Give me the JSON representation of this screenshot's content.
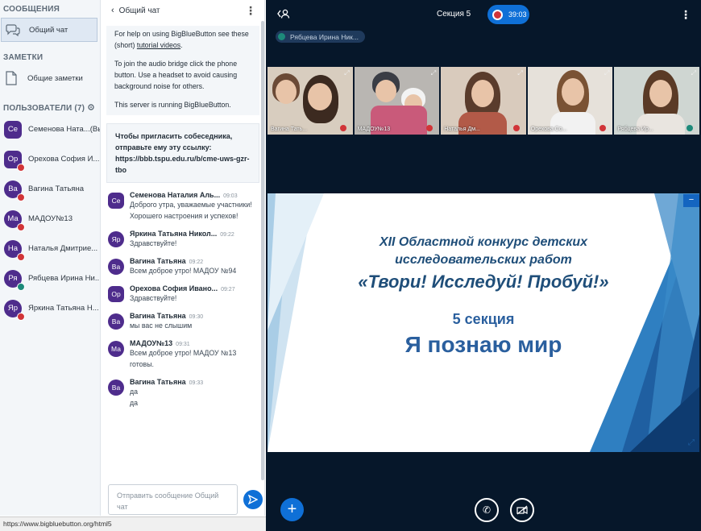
{
  "sidebar": {
    "messages_header": "СООБЩЕНИЯ",
    "public_chat_label": "Общий чат",
    "notes_header": "ЗАМЕТКИ",
    "shared_notes_label": "Общие заметки",
    "users_header": "ПОЛЬЗОВАТЕЛИ (7)",
    "users": [
      {
        "initials": "Се",
        "name": "Семенова Ната...(Вы)",
        "badge": "none",
        "shape": "square"
      },
      {
        "initials": "Ор",
        "name": "Орехова София И...",
        "badge": "red",
        "shape": "square"
      },
      {
        "initials": "Ва",
        "name": "Вагина Татьяна",
        "badge": "red",
        "shape": "round"
      },
      {
        "initials": "Ма",
        "name": "МАДОУ№13",
        "badge": "red",
        "shape": "round"
      },
      {
        "initials": "На",
        "name": "Наталья Дмитрие...",
        "badge": "red",
        "shape": "round"
      },
      {
        "initials": "Ря",
        "name": "Рябцева Ирина Ни...",
        "badge": "green",
        "shape": "round"
      },
      {
        "initials": "Яр",
        "name": "Яркина Татьяна Н...",
        "badge": "red",
        "shape": "round"
      }
    ]
  },
  "chat": {
    "title": "Общий чат",
    "welcome": {
      "p1_a": "For help on using BigBlueButton see these (short) ",
      "p1_link": "tutorial videos",
      "p1_b": ".",
      "p2": "To join the audio bridge click the phone button. Use a headset to avoid causing background noise for others.",
      "p3": "This server is running BigBlueButton."
    },
    "invite": {
      "text": "Чтобы пригласить собеседника, отправьте ему эту ссылку:",
      "link": "https://bbb.tspu.edu.ru/b/cme-uws-gzr-tbo"
    },
    "messages": [
      {
        "initials": "Се",
        "shape": "square",
        "name": "Семенова Наталия Аль...",
        "time": "09:03",
        "lines": [
          "Доброго утра, уважаемые участники! Хорошего настроения и успехов!"
        ]
      },
      {
        "initials": "Яр",
        "shape": "round",
        "name": "Яркина Татьяна Никол...",
        "time": "09:22",
        "lines": [
          "Здравствуйте!"
        ]
      },
      {
        "initials": "Ва",
        "shape": "round",
        "name": "Вагина Татьяна",
        "time": "09:22",
        "lines": [
          "Всем доброе утро! МАДОУ №94"
        ]
      },
      {
        "initials": "Ор",
        "shape": "square",
        "name": "Орехова София Ивано...",
        "time": "09:27",
        "lines": [
          "Здравствуйте!"
        ]
      },
      {
        "initials": "Ва",
        "shape": "round",
        "name": "Вагина Татьяна",
        "time": "09:30",
        "lines": [
          "мы вас не слышим"
        ]
      },
      {
        "initials": "Ма",
        "shape": "round",
        "name": "МАДОУ№13",
        "time": "09:31",
        "lines": [
          "Всем доброе утро! МАДОУ №13 готовы."
        ]
      },
      {
        "initials": "Ва",
        "shape": "round",
        "name": "Вагина Татьяна",
        "time": "09:33",
        "lines": [
          "да",
          "да"
        ]
      }
    ],
    "input_placeholder": "Отправить сообщение Общий чат"
  },
  "status_url": "https://www.bigbluebutton.org/html5",
  "topbar": {
    "title": "Секция 5",
    "record_time": "39:03"
  },
  "talker": "Рябцева Ирина Ник...",
  "videos": [
    {
      "label": "Вагина Тать..."
    },
    {
      "label": "МАДОУ№13"
    },
    {
      "label": "Наталья Дм..."
    },
    {
      "label": "Орехова Со..."
    },
    {
      "label": "Рябцева Ир..."
    }
  ],
  "slide": {
    "line1": "XII Областной конкурс детских",
    "line2": "исследовательских работ",
    "line3": "«Твори! Исследуй! Пробуй!»",
    "line4": "5 секция",
    "line5": "Я познаю мир"
  },
  "colors": {
    "primary": "#0f70d7",
    "avatar": "#4e2c8c",
    "dark_bg": "#06172a",
    "muted_red": "#d13438",
    "talk_green": "#1d8a7a"
  }
}
